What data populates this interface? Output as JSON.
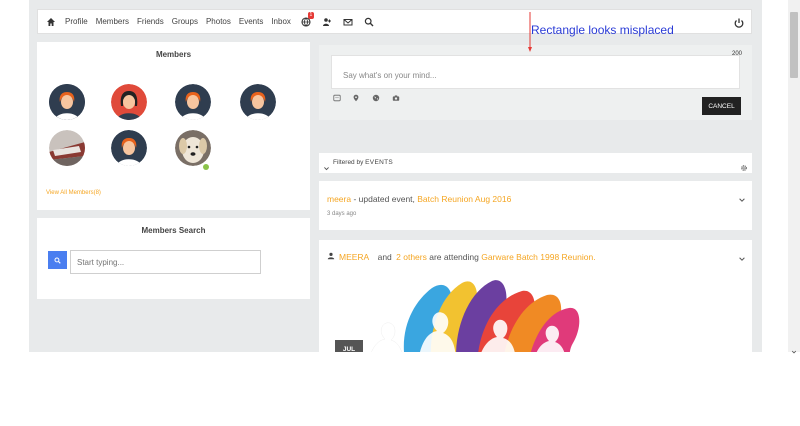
{
  "nav": {
    "items": [
      "Profile",
      "Members",
      "Friends",
      "Groups",
      "Photos",
      "Events",
      "Inbox"
    ],
    "notification_count": "1"
  },
  "members_panel": {
    "title": "Members",
    "view_all": "View All Members(8)"
  },
  "members_search": {
    "title": "Members Search",
    "placeholder": "Start typing..."
  },
  "composer": {
    "placeholder": "Say what's on your mind...",
    "char_limit": "200",
    "cancel_label": "CANCEL"
  },
  "filter": {
    "prefix": "Filtered by",
    "value": "EVENTS"
  },
  "feed": [
    {
      "actor": "meera",
      "action": " - updated event, ",
      "target": "Batch Reunion Aug 2016",
      "time": "3 days ago"
    },
    {
      "actor": "MEERA",
      "joiner": " and ",
      "others": "2 others",
      "action": " are attending ",
      "target": "Garware Batch 1998 Reunion.",
      "date_badge": "JUL"
    }
  ],
  "annotation": {
    "text": "Rectangle looks misplaced",
    "color": "#2a3bd6"
  },
  "colors": {
    "accent": "#f5a623",
    "search_button": "#4a7ef0",
    "avatar_dark": "#2f3d4f",
    "avatar_red": "#e04a3a"
  }
}
